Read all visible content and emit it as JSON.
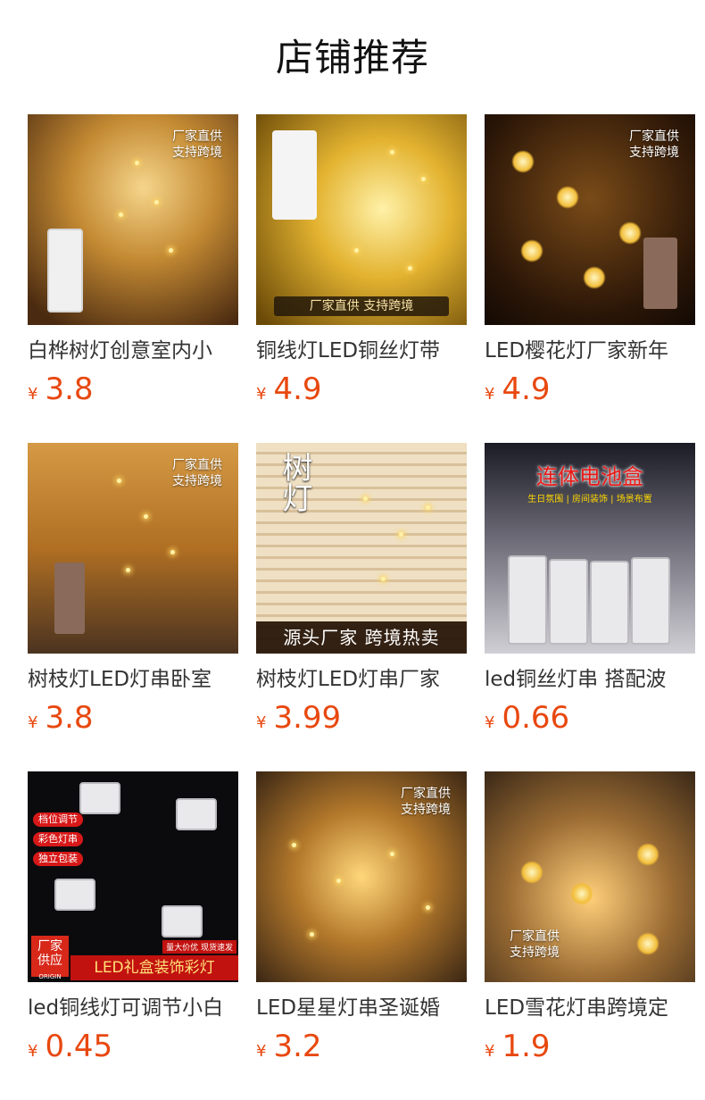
{
  "title": "店铺推荐",
  "colors": {
    "price": "#e8480f",
    "text": "#333333"
  },
  "products": [
    {
      "name": "白桦树灯创意室内小",
      "yen": "¥",
      "price": "3.8",
      "badge": [
        "厂家直供",
        "支持跨境"
      ]
    },
    {
      "name": "铜线灯LED铜丝灯带",
      "yen": "¥",
      "price": "4.9",
      "banner": "厂家直供  支持跨境"
    },
    {
      "name": "LED樱花灯厂家新年",
      "yen": "¥",
      "price": "4.9",
      "badge": [
        "厂家直供",
        "支持跨境"
      ]
    },
    {
      "name": "树枝灯LED灯串卧室",
      "yen": "¥",
      "price": "3.8",
      "badge": [
        "厂家直供",
        "支持跨境"
      ]
    },
    {
      "name": "树枝灯LED灯串厂家",
      "yen": "¥",
      "price": "3.99",
      "vertical": "树灯",
      "banner": "源头厂家  跨境热卖"
    },
    {
      "name": "led铜丝灯串 搭配波",
      "yen": "¥",
      "price": "0.66",
      "top": "连体电池盒",
      "top_sub": "生日氛围 | 房间装饰 | 场景布置"
    },
    {
      "name": "led铜线灯可调节小白",
      "yen": "¥",
      "price": "0.45",
      "tags": [
        "档位调节",
        "彩色灯串",
        "独立包装"
      ],
      "corner": [
        "厂家",
        "供应",
        "ORIGIN"
      ],
      "small_tag": "量大价优 现货速发",
      "banner": "LED礼盒装饰彩灯"
    },
    {
      "name": "LED星星灯串圣诞婚",
      "yen": "¥",
      "price": "3.2",
      "badge": [
        "厂家直供",
        "支持跨境"
      ]
    },
    {
      "name": "LED雪花灯串跨境定",
      "yen": "¥",
      "price": "1.9",
      "badge": [
        "厂家直供",
        "支持跨境"
      ]
    }
  ]
}
